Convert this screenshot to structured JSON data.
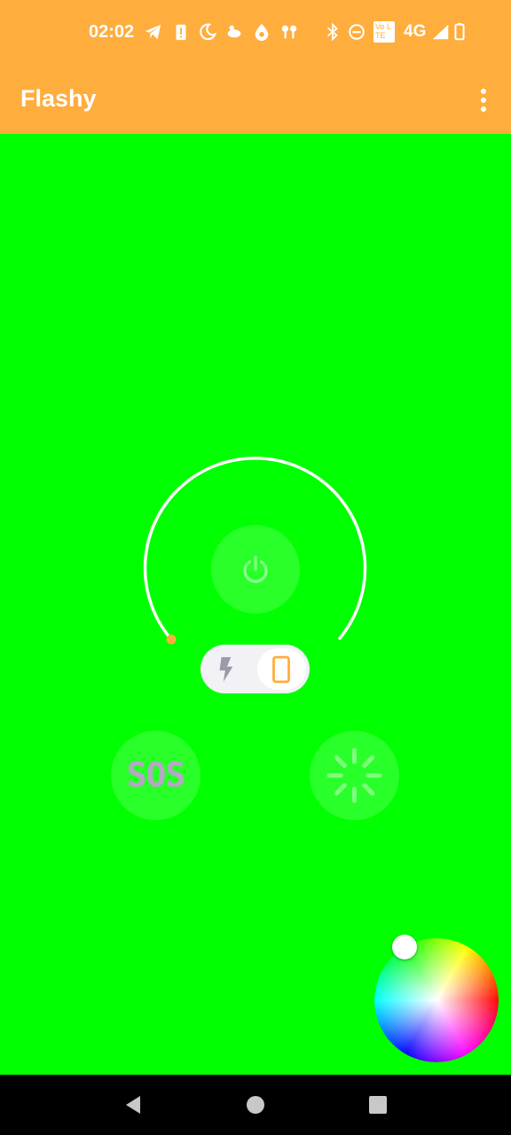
{
  "status_bar": {
    "time": "02:02",
    "network": "4G",
    "icons": [
      "telegram-icon",
      "battery-alert-icon",
      "night-mode-icon",
      "notification-icon",
      "drop-icon",
      "earbuds-icon",
      "bluetooth-icon",
      "dnd-icon",
      "volte-icon",
      "signal-icon",
      "battery-icon"
    ],
    "volte_text": "Vo LTE"
  },
  "app_bar": {
    "title": "Flashy",
    "menu_icon": "more-vert-icon"
  },
  "controls": {
    "power_icon": "power-icon",
    "mode_toggle": {
      "options": [
        "flash-icon",
        "screen-icon"
      ],
      "selected": "screen-icon"
    },
    "sos_label": "SOS",
    "strobe_icon": "strobe-icon",
    "accent_color": "#ffad3c",
    "background_color": "#00ff00"
  },
  "navigation": {
    "icons": [
      "back-icon",
      "home-icon",
      "recents-icon"
    ]
  }
}
